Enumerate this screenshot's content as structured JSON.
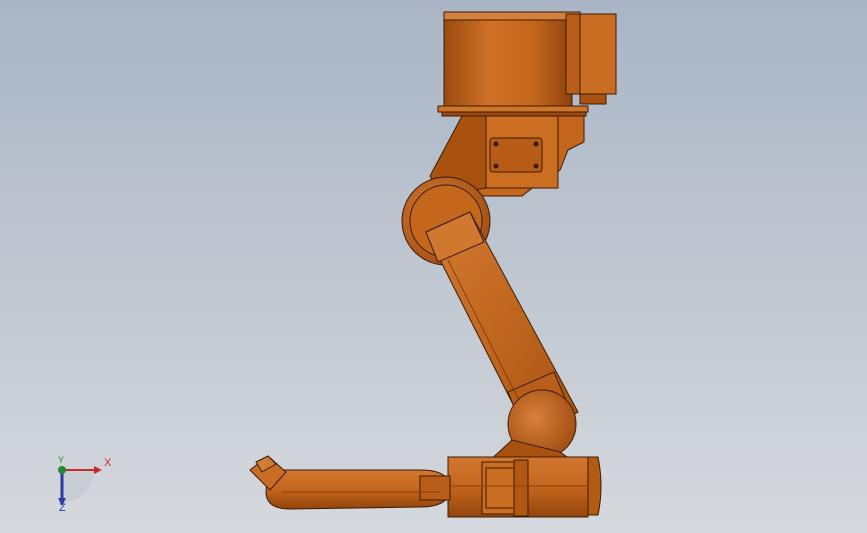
{
  "viewport": {
    "background_top": "#a9b5c6",
    "background_bottom": "#d6d9de"
  },
  "model": {
    "body_color": "#c4661c",
    "shadow_color": "#8a3e08",
    "highlight_color": "#e08a3c",
    "outline_color": "#3a1c06"
  },
  "triad": {
    "x_label": "X",
    "y_label": "Y",
    "z_label": "Z",
    "x_color": "#cc2a2a",
    "y_color": "#1f8a33",
    "z_color": "#2a3aa8"
  }
}
